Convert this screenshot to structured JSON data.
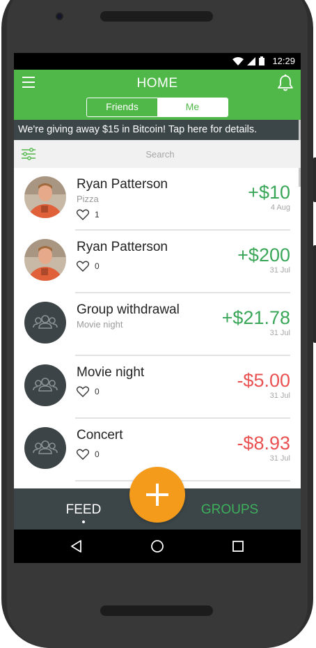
{
  "status_bar": {
    "time": "12:29"
  },
  "app_bar": {
    "title": "HOME"
  },
  "segment": {
    "friends_label": "Friends",
    "me_label": "Me",
    "selected": "Me"
  },
  "promo": {
    "text": "We're giving away $15 in Bitcoin! Tap here for details."
  },
  "search": {
    "placeholder": "Search"
  },
  "transactions": [
    {
      "name": "Ryan Patterson",
      "note": "Pizza",
      "likes": "1",
      "amount": "+$10",
      "date": "4 Aug",
      "type": "positive",
      "avatar": "photo"
    },
    {
      "name": "Ryan Patterson",
      "note": "",
      "likes": "0",
      "amount": "+$200",
      "date": "31 Jul",
      "type": "positive",
      "avatar": "photo"
    },
    {
      "name": "Group withdrawal",
      "note": "Movie night",
      "likes": "",
      "amount": "+$21.78",
      "date": "31 Jul",
      "type": "positive",
      "avatar": "group-icon"
    },
    {
      "name": "Movie night",
      "note": "",
      "likes": "0",
      "amount": "-$5.00",
      "date": "31 Jul",
      "type": "negative",
      "avatar": "group-icon"
    },
    {
      "name": "Concert",
      "note": "",
      "likes": "0",
      "amount": "-$8.93",
      "date": "31 Jul",
      "type": "negative",
      "avatar": "group-icon"
    }
  ],
  "bottom_nav": {
    "feed_label": "FEED",
    "groups_label": "GROUPS",
    "active": "FEED"
  },
  "colors": {
    "brand_green": "#50b848",
    "positive": "#3aa657",
    "negative": "#ea5252",
    "fab_orange": "#f49b1b",
    "dark_panel": "#3c4649"
  }
}
